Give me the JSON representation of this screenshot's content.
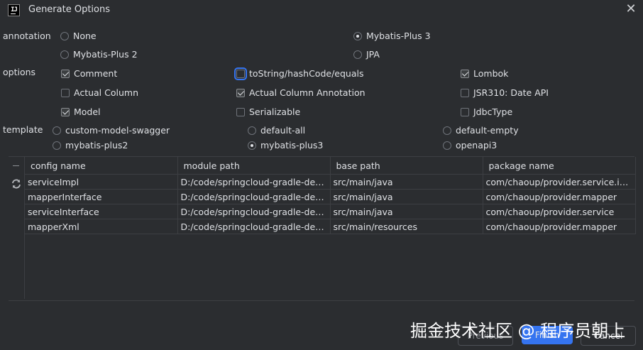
{
  "window": {
    "title": "Generate Options",
    "icon": "intellij-icon",
    "close_icon": "close-icon"
  },
  "annotation": {
    "label": "annotation",
    "options": [
      {
        "label": "None",
        "selected": false
      },
      {
        "label": "Mybatis-Plus 3",
        "selected": true
      },
      {
        "label": "Mybatis-Plus 2",
        "selected": false
      },
      {
        "label": "JPA",
        "selected": false
      }
    ]
  },
  "options": {
    "label": "options",
    "items": [
      {
        "label": "Comment",
        "checked": true
      },
      {
        "label": "toString/hashCode/equals",
        "checked": false
      },
      {
        "label": "Lombok",
        "checked": true
      },
      {
        "label": "Actual Column",
        "checked": false
      },
      {
        "label": "Actual Column Annotation",
        "checked": true
      },
      {
        "label": "JSR310: Date API",
        "checked": false
      },
      {
        "label": "Model",
        "checked": true
      },
      {
        "label": "Serializable",
        "checked": false
      },
      {
        "label": "JdbcType",
        "checked": false
      }
    ]
  },
  "template": {
    "label": "template",
    "options": [
      {
        "label": "custom-model-swagger",
        "selected": false
      },
      {
        "label": "default-all",
        "selected": false
      },
      {
        "label": "default-empty",
        "selected": false
      },
      {
        "label": "mybatis-plus2",
        "selected": false
      },
      {
        "label": "mybatis-plus3",
        "selected": true
      },
      {
        "label": "openapi3",
        "selected": false
      }
    ]
  },
  "table": {
    "headers": [
      "config name",
      "module path",
      "base path",
      "package name"
    ],
    "rows": [
      [
        "serviceImpl",
        "D:/code/springcloud-gradle-dem...",
        "src/main/java",
        "com/chaoup/provider.service.impl"
      ],
      [
        "mapperInterface",
        "D:/code/springcloud-gradle-dem...",
        "src/main/java",
        "com/chaoup/provider.mapper"
      ],
      [
        "serviceInterface",
        "D:/code/springcloud-gradle-dem...",
        "src/main/java",
        "com/chaoup/provider.service"
      ],
      [
        "mapperXml",
        "D:/code/springcloud-gradle-dem...",
        "src/main/resources",
        "com/chaoup/provider.mapper"
      ]
    ]
  },
  "buttons": {
    "previous": "Previous",
    "finish": "Finish",
    "cancel": "Cancel"
  },
  "watermark": "掘金技术社区 @ 程序员朝上",
  "colors": {
    "background": "#2b2d30",
    "accent": "#3574f0",
    "grid": "#3d3f43"
  }
}
